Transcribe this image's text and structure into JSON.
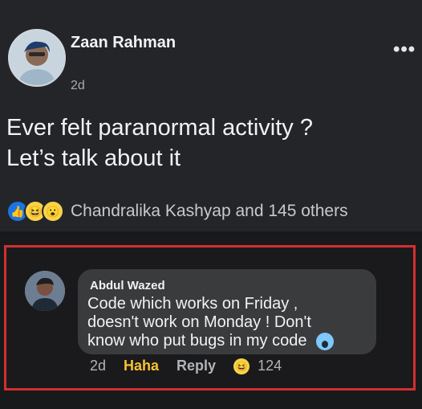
{
  "post": {
    "author": "Zaan Rahman",
    "time": "2d",
    "text_line1": "Ever felt paranormal activity ?",
    "text_line2": "Let’s talk about it",
    "more": "•••",
    "reactions": {
      "icons": [
        "like-icon",
        "haha-icon",
        "wow-icon"
      ],
      "summary": "Chandralika Kashyap and 145 others"
    }
  },
  "comment": {
    "author": "Abdul Wazed",
    "text_line1": "Code which works on Friday ,",
    "text_line2": "doesn't work on Monday ! Don't",
    "text_line3": "know who put bugs in my code",
    "time": "2d",
    "haha": "Haha",
    "reply": "Reply",
    "reaction_count": "124"
  },
  "colors": {
    "accent_haha": "#f7c233",
    "like_blue": "#1b74e4",
    "highlight": "#d32f2f"
  }
}
